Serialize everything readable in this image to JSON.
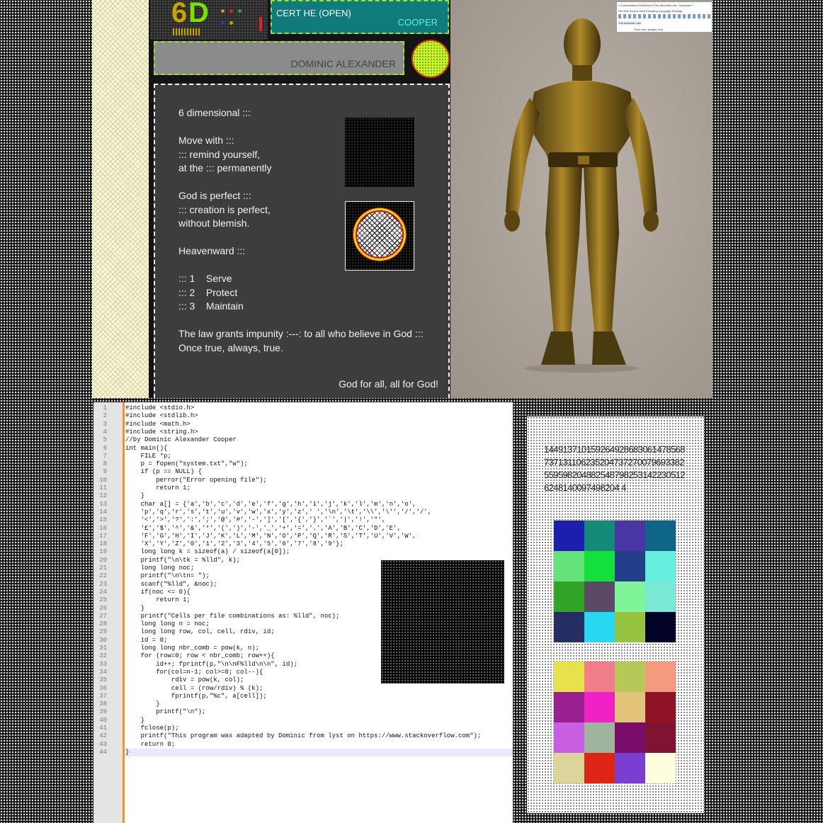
{
  "logo": {
    "six": "6",
    "d": "D"
  },
  "cert": {
    "title": "CERT HE (OPEN)",
    "name": "COOPER"
  },
  "name_box": {
    "name": "DOMINIC ALEXANDER"
  },
  "panel": {
    "lines": [
      "6 dimensional :::",
      "Move with :::",
      "::: remind yourself,",
      "at the ::: permanently",
      "God is perfect :::",
      "::: creation is perfect,",
      "without blemish.",
      "Heavenward :::",
      "::: 1    Serve",
      "::: 2    Protect",
      "::: 3    Maintain",
      "The law grants impunity :---: to all who believe in God :::",
      "Once true, always, true."
    ],
    "footer": "God for all, all for God!"
  },
  "mini_window": {
    "title": "C:\\Users\\dacoo\\OneDrive\\C\\The Absolute Law - Notepad++",
    "menu": "File  Edit  Search  View  Encoding  Language  Settings",
    "tab": "The Absolute Law",
    "line": "Once true, always, true."
  },
  "code": {
    "lines": [
      "#include <stdio.h>",
      "#include <stdlib.h>",
      "#include <math.h>",
      "#include <string.h>",
      "//by Dominic Alexander Cooper",
      "int main(){",
      "    FILE *p;",
      "    p = fopen(\"system.txt\",\"w\");",
      "    if (p == NULL) {",
      "        perror(\"Error opening file\");",
      "        return 1;",
      "    }",
      "    char a[] = {'a','b','c','d','e','f','g','h','i','j','k','l','m','n','o',",
      "    'p','q','r','s','t','u','v','w','x','y','z',' ','\\n','\\t','\\\\','\\'','/','/',",
      "    '<','>','?',':',';','@','#','-',']','[','{','}','`','|','!','\"',",
      "    '£','$','^','&','*','(',')','-','_','+','=','.','A','B','C','D','E',",
      "    'F','G','H','I','J','K','L','M','N','O','P','Q','R','S','T','U','V','W',",
      "    'X','Y','Z','0','1','2','3','4','5','6','7','8','9'};",
      "    long long k = sizeof(a) / sizeof(a[0]);",
      "    printf(\"\\n\\tk = %lld\", k);",
      "    long long noc;",
      "    printf(\"\\n\\tn= \");",
      "    scanf(\"%lld\", &noc);",
      "    if(noc <= 0){",
      "        return 1;",
      "    }",
      "    printf(\"Cells per file combinations as: %lld\", noc);",
      "    long long n = noc;",
      "    long long row, col, cell, rdiv, id;",
      "    id = 0;",
      "    long long nbr_comb = pow(k, n);",
      "    for (row=0; row < nbr_comb; row++){",
      "        id++; fprintf(p,\"\\n\\nF%lld\\n\\n\", id);",
      "        for(col=n-1; col>=0; col--){",
      "            rdiv = pow(k, col);",
      "            cell = (row/rdiv) % (k);",
      "            fprintf(p,\"%c\", a[cell]);",
      "        }",
      "        printf(\"\\n\");",
      "    }",
      "    fclose(p);",
      "    printf(\"This program was adapted by Dominic from lyst on https://www.stackoverflow.com\");",
      "    return 0;",
      "}"
    ]
  },
  "number": {
    "value": "1449137101592649286830614785687371311062352047372700796933825595982048825487982531422305126248140097498204 4"
  },
  "swatches": {
    "grid1": [
      "#1b1fad",
      "#138a7a",
      "#4a35a5",
      "#0f6585",
      "#66e27a",
      "#13e03a",
      "#233f8a",
      "#66efdf",
      "#32a42a",
      "#5b4a66",
      "#7ff499",
      "#7ae9d5",
      "#252e63",
      "#28d8f2",
      "#96c440",
      "#030228"
    ],
    "grid2": [
      "#e7e24a",
      "#ef7e8a",
      "#b6c858",
      "#f59a7e",
      "#9a2091",
      "#ef22c6",
      "#e2c479",
      "#8e1324",
      "#c85ee2",
      "#9fb49c",
      "#7a0d6a",
      "#7e1432",
      "#ddd49a",
      "#de2414",
      "#7a3ed1",
      "#fffedc"
    ]
  }
}
